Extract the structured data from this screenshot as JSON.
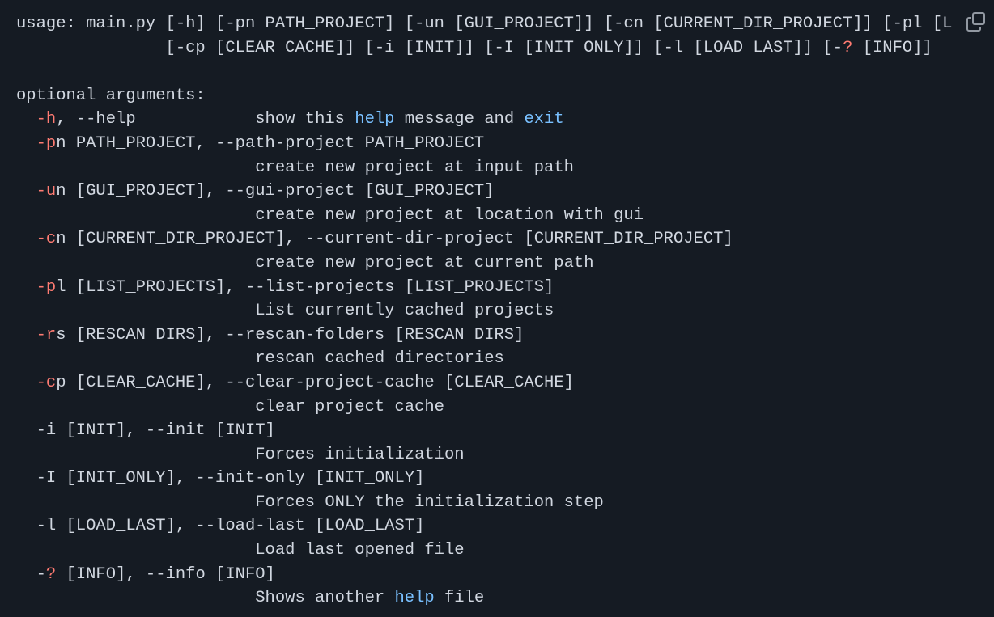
{
  "code_lines": [
    [
      {
        "t": "usage: main.py [-h] [-pn PATH_PROJECT] [-un [GUI_PROJECT]] [-cn [CURRENT_DIR_PROJECT]] [-pl [L"
      }
    ],
    [
      {
        "t": "               [-cp [CLEAR_CACHE]] [-i [INIT]] [-I [INIT_ONLY]] [-l [LOAD_LAST]] [-"
      },
      {
        "t": "?",
        "c": "r"
      },
      {
        "t": " [INFO]]"
      }
    ],
    [
      {
        "t": ""
      }
    ],
    [
      {
        "t": "optional arguments:"
      }
    ],
    [
      {
        "t": "  "
      },
      {
        "t": "-h",
        "c": "r"
      },
      {
        "t": ", --help            show this "
      },
      {
        "t": "help",
        "c": "b"
      },
      {
        "t": " message and "
      },
      {
        "t": "exit",
        "c": "b"
      }
    ],
    [
      {
        "t": "  "
      },
      {
        "t": "-p",
        "c": "r"
      },
      {
        "t": "n PATH_PROJECT, --path-project PATH_PROJECT"
      }
    ],
    [
      {
        "t": "                        create new project at input path"
      }
    ],
    [
      {
        "t": "  "
      },
      {
        "t": "-u",
        "c": "r"
      },
      {
        "t": "n [GUI_PROJECT], --gui-project [GUI_PROJECT]"
      }
    ],
    [
      {
        "t": "                        create new project at location with gui"
      }
    ],
    [
      {
        "t": "  "
      },
      {
        "t": "-c",
        "c": "r"
      },
      {
        "t": "n [CURRENT_DIR_PROJECT], --current-dir-project [CURRENT_DIR_PROJECT]"
      }
    ],
    [
      {
        "t": "                        create new project at current path"
      }
    ],
    [
      {
        "t": "  "
      },
      {
        "t": "-p",
        "c": "r"
      },
      {
        "t": "l [LIST_PROJECTS], --list-projects [LIST_PROJECTS]"
      }
    ],
    [
      {
        "t": "                        List currently cached projects"
      }
    ],
    [
      {
        "t": "  "
      },
      {
        "t": "-r",
        "c": "r"
      },
      {
        "t": "s [RESCAN_DIRS], --rescan-folders [RESCAN_DIRS]"
      }
    ],
    [
      {
        "t": "                        rescan cached directories"
      }
    ],
    [
      {
        "t": "  "
      },
      {
        "t": "-c",
        "c": "r"
      },
      {
        "t": "p [CLEAR_CACHE], --clear-project-cache [CLEAR_CACHE]"
      }
    ],
    [
      {
        "t": "                        clear project cache"
      }
    ],
    [
      {
        "t": "  -i [INIT], --init [INIT]"
      }
    ],
    [
      {
        "t": "                        Forces initialization"
      }
    ],
    [
      {
        "t": "  -I [INIT_ONLY], --init-only [INIT_ONLY]"
      }
    ],
    [
      {
        "t": "                        Forces ONLY the initialization step"
      }
    ],
    [
      {
        "t": "  -l [LOAD_LAST], --load-last [LOAD_LAST]"
      }
    ],
    [
      {
        "t": "                        Load last opened file"
      }
    ],
    [
      {
        "t": "  -"
      },
      {
        "t": "?",
        "c": "r"
      },
      {
        "t": " [INFO], --info [INFO]"
      }
    ],
    [
      {
        "t": "                        Shows another "
      },
      {
        "t": "help",
        "c": "b"
      },
      {
        "t": " file"
      }
    ]
  ],
  "copy_button": {
    "icon": "copy-icon"
  },
  "colors": {
    "background": "#151b23",
    "text": "#d1d7e0",
    "keyword": "#ff7b72",
    "builtin": "#79c0ff"
  }
}
